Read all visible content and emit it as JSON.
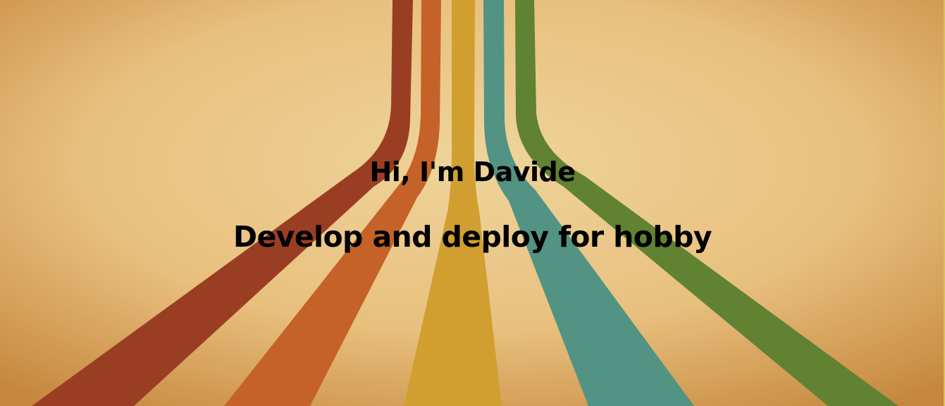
{
  "hero": {
    "title": "Hi, I'm Davide",
    "subtitle": "Develop and deploy for hobby"
  },
  "colors": {
    "background_light": "#f2cf8e",
    "background_dark": "#c98a3f",
    "stripe_rust": "#9c3d24",
    "stripe_orange": "#c9632a",
    "stripe_mustard": "#d6a431",
    "stripe_teal": "#4f978a",
    "stripe_olive": "#5e8533",
    "text": "#000000"
  }
}
